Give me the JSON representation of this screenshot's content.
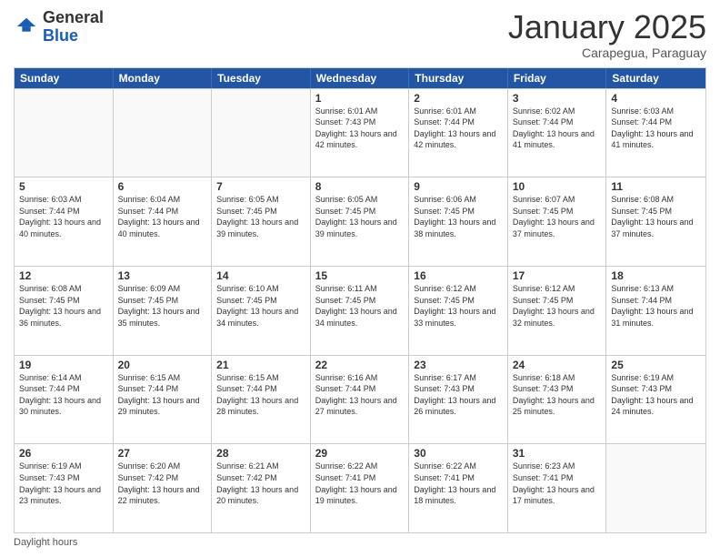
{
  "logo": {
    "general": "General",
    "blue": "Blue"
  },
  "title": "January 2025",
  "location": "Carapegua, Paraguay",
  "days_of_week": [
    "Sunday",
    "Monday",
    "Tuesday",
    "Wednesday",
    "Thursday",
    "Friday",
    "Saturday"
  ],
  "footer": "Daylight hours",
  "weeks": [
    [
      {
        "num": "",
        "sunrise": "",
        "sunset": "",
        "daylight": ""
      },
      {
        "num": "",
        "sunrise": "",
        "sunset": "",
        "daylight": ""
      },
      {
        "num": "",
        "sunrise": "",
        "sunset": "",
        "daylight": ""
      },
      {
        "num": "1",
        "sunrise": "Sunrise: 6:01 AM",
        "sunset": "Sunset: 7:43 PM",
        "daylight": "Daylight: 13 hours and 42 minutes."
      },
      {
        "num": "2",
        "sunrise": "Sunrise: 6:01 AM",
        "sunset": "Sunset: 7:44 PM",
        "daylight": "Daylight: 13 hours and 42 minutes."
      },
      {
        "num": "3",
        "sunrise": "Sunrise: 6:02 AM",
        "sunset": "Sunset: 7:44 PM",
        "daylight": "Daylight: 13 hours and 41 minutes."
      },
      {
        "num": "4",
        "sunrise": "Sunrise: 6:03 AM",
        "sunset": "Sunset: 7:44 PM",
        "daylight": "Daylight: 13 hours and 41 minutes."
      }
    ],
    [
      {
        "num": "5",
        "sunrise": "Sunrise: 6:03 AM",
        "sunset": "Sunset: 7:44 PM",
        "daylight": "Daylight: 13 hours and 40 minutes."
      },
      {
        "num": "6",
        "sunrise": "Sunrise: 6:04 AM",
        "sunset": "Sunset: 7:44 PM",
        "daylight": "Daylight: 13 hours and 40 minutes."
      },
      {
        "num": "7",
        "sunrise": "Sunrise: 6:05 AM",
        "sunset": "Sunset: 7:45 PM",
        "daylight": "Daylight: 13 hours and 39 minutes."
      },
      {
        "num": "8",
        "sunrise": "Sunrise: 6:05 AM",
        "sunset": "Sunset: 7:45 PM",
        "daylight": "Daylight: 13 hours and 39 minutes."
      },
      {
        "num": "9",
        "sunrise": "Sunrise: 6:06 AM",
        "sunset": "Sunset: 7:45 PM",
        "daylight": "Daylight: 13 hours and 38 minutes."
      },
      {
        "num": "10",
        "sunrise": "Sunrise: 6:07 AM",
        "sunset": "Sunset: 7:45 PM",
        "daylight": "Daylight: 13 hours and 37 minutes."
      },
      {
        "num": "11",
        "sunrise": "Sunrise: 6:08 AM",
        "sunset": "Sunset: 7:45 PM",
        "daylight": "Daylight: 13 hours and 37 minutes."
      }
    ],
    [
      {
        "num": "12",
        "sunrise": "Sunrise: 6:08 AM",
        "sunset": "Sunset: 7:45 PM",
        "daylight": "Daylight: 13 hours and 36 minutes."
      },
      {
        "num": "13",
        "sunrise": "Sunrise: 6:09 AM",
        "sunset": "Sunset: 7:45 PM",
        "daylight": "Daylight: 13 hours and 35 minutes."
      },
      {
        "num": "14",
        "sunrise": "Sunrise: 6:10 AM",
        "sunset": "Sunset: 7:45 PM",
        "daylight": "Daylight: 13 hours and 34 minutes."
      },
      {
        "num": "15",
        "sunrise": "Sunrise: 6:11 AM",
        "sunset": "Sunset: 7:45 PM",
        "daylight": "Daylight: 13 hours and 34 minutes."
      },
      {
        "num": "16",
        "sunrise": "Sunrise: 6:12 AM",
        "sunset": "Sunset: 7:45 PM",
        "daylight": "Daylight: 13 hours and 33 minutes."
      },
      {
        "num": "17",
        "sunrise": "Sunrise: 6:12 AM",
        "sunset": "Sunset: 7:45 PM",
        "daylight": "Daylight: 13 hours and 32 minutes."
      },
      {
        "num": "18",
        "sunrise": "Sunrise: 6:13 AM",
        "sunset": "Sunset: 7:44 PM",
        "daylight": "Daylight: 13 hours and 31 minutes."
      }
    ],
    [
      {
        "num": "19",
        "sunrise": "Sunrise: 6:14 AM",
        "sunset": "Sunset: 7:44 PM",
        "daylight": "Daylight: 13 hours and 30 minutes."
      },
      {
        "num": "20",
        "sunrise": "Sunrise: 6:15 AM",
        "sunset": "Sunset: 7:44 PM",
        "daylight": "Daylight: 13 hours and 29 minutes."
      },
      {
        "num": "21",
        "sunrise": "Sunrise: 6:15 AM",
        "sunset": "Sunset: 7:44 PM",
        "daylight": "Daylight: 13 hours and 28 minutes."
      },
      {
        "num": "22",
        "sunrise": "Sunrise: 6:16 AM",
        "sunset": "Sunset: 7:44 PM",
        "daylight": "Daylight: 13 hours and 27 minutes."
      },
      {
        "num": "23",
        "sunrise": "Sunrise: 6:17 AM",
        "sunset": "Sunset: 7:43 PM",
        "daylight": "Daylight: 13 hours and 26 minutes."
      },
      {
        "num": "24",
        "sunrise": "Sunrise: 6:18 AM",
        "sunset": "Sunset: 7:43 PM",
        "daylight": "Daylight: 13 hours and 25 minutes."
      },
      {
        "num": "25",
        "sunrise": "Sunrise: 6:19 AM",
        "sunset": "Sunset: 7:43 PM",
        "daylight": "Daylight: 13 hours and 24 minutes."
      }
    ],
    [
      {
        "num": "26",
        "sunrise": "Sunrise: 6:19 AM",
        "sunset": "Sunset: 7:43 PM",
        "daylight": "Daylight: 13 hours and 23 minutes."
      },
      {
        "num": "27",
        "sunrise": "Sunrise: 6:20 AM",
        "sunset": "Sunset: 7:42 PM",
        "daylight": "Daylight: 13 hours and 22 minutes."
      },
      {
        "num": "28",
        "sunrise": "Sunrise: 6:21 AM",
        "sunset": "Sunset: 7:42 PM",
        "daylight": "Daylight: 13 hours and 20 minutes."
      },
      {
        "num": "29",
        "sunrise": "Sunrise: 6:22 AM",
        "sunset": "Sunset: 7:41 PM",
        "daylight": "Daylight: 13 hours and 19 minutes."
      },
      {
        "num": "30",
        "sunrise": "Sunrise: 6:22 AM",
        "sunset": "Sunset: 7:41 PM",
        "daylight": "Daylight: 13 hours and 18 minutes."
      },
      {
        "num": "31",
        "sunrise": "Sunrise: 6:23 AM",
        "sunset": "Sunset: 7:41 PM",
        "daylight": "Daylight: 13 hours and 17 minutes."
      },
      {
        "num": "",
        "sunrise": "",
        "sunset": "",
        "daylight": ""
      }
    ]
  ]
}
